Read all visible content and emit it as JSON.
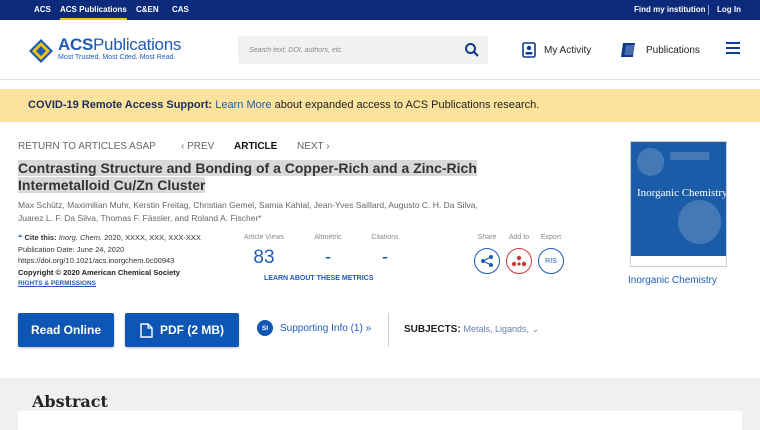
{
  "topnav": {
    "acs": "ACS",
    "pubs": "ACS Publications",
    "cen": "C&EN",
    "cas": "CAS",
    "find": "Find my institution",
    "login": "Log In"
  },
  "header": {
    "logo_title_a": "ACS",
    "logo_title_b": "Publications",
    "logo_tag": "Most Trusted. Most Cited. Most Read.",
    "search_placeholder": "Search text, DOI, authors, etc.",
    "my_activity": "My Activity",
    "publications": "Publications"
  },
  "banner": {
    "lead": "COVID-19 Remote Access Support:",
    "link": "Learn More",
    "rest": " about expanded access to ACS Publications research."
  },
  "article_nav": {
    "back": "RETURN TO ARTICLES ASAP",
    "prev": "‹ PREV",
    "current": "ARTICLE",
    "next": "NEXT ›"
  },
  "article": {
    "title_line1": "Contrasting Structure and Bonding of a Copper-Rich and a Zinc-Rich",
    "title_line2": "Intermetalloid Cu/Zn Cluster",
    "authors_line1": "Max Schütz, Maximilian Muhr, Kerstin Freitag, Christian Gemel, Samia Kahlal, Jean-Yves Saillard, Augusto C. H. Da Silva,",
    "authors_line2": "Juarez L. F. Da Silva, Thomas F. Fässler, and Roland A. Fischer*"
  },
  "cite": {
    "label": "Cite this:",
    "journal": "Inorg. Chem.",
    "ref": " 2020, XXXX, XXX, XXX-XXX",
    "pubdate": "Publication Date: June 24, 2020",
    "doi": "https://doi.org/10.1021/acs.inorgchem.0c00943",
    "copyright": "Copyright © 2020 American Chemical Society",
    "rights": "RIGHTS & PERMISSIONS"
  },
  "metrics": {
    "views_label": "Article Views",
    "views_value": "83",
    "alt_label": "Altmetric",
    "alt_value": "-",
    "cite_label": "Citations",
    "cite_value": "-",
    "learn": "LEARN ABOUT THESE METRICS"
  },
  "share": {
    "share_label": "Share",
    "add_label": "Add to",
    "export_label": "Export",
    "ris": "RIS"
  },
  "journal": {
    "cover_title": "Inorganic Chemistry",
    "name": "Inorganic Chemistry"
  },
  "actions": {
    "read_online": "Read Online",
    "pdf": "PDF (2 MB)",
    "si_badge": "SI",
    "supporting": "Supporting Info (1) »",
    "subjects_label": "SUBJECTS:",
    "subjects_values": "Metals, Ligands, ⌄"
  },
  "abstract": {
    "heading": "Abstract"
  },
  "colors": {
    "navy": "#0b2a7a",
    "accent_blue": "#1f5bb6",
    "banner_yellow": "#fbe39d"
  }
}
